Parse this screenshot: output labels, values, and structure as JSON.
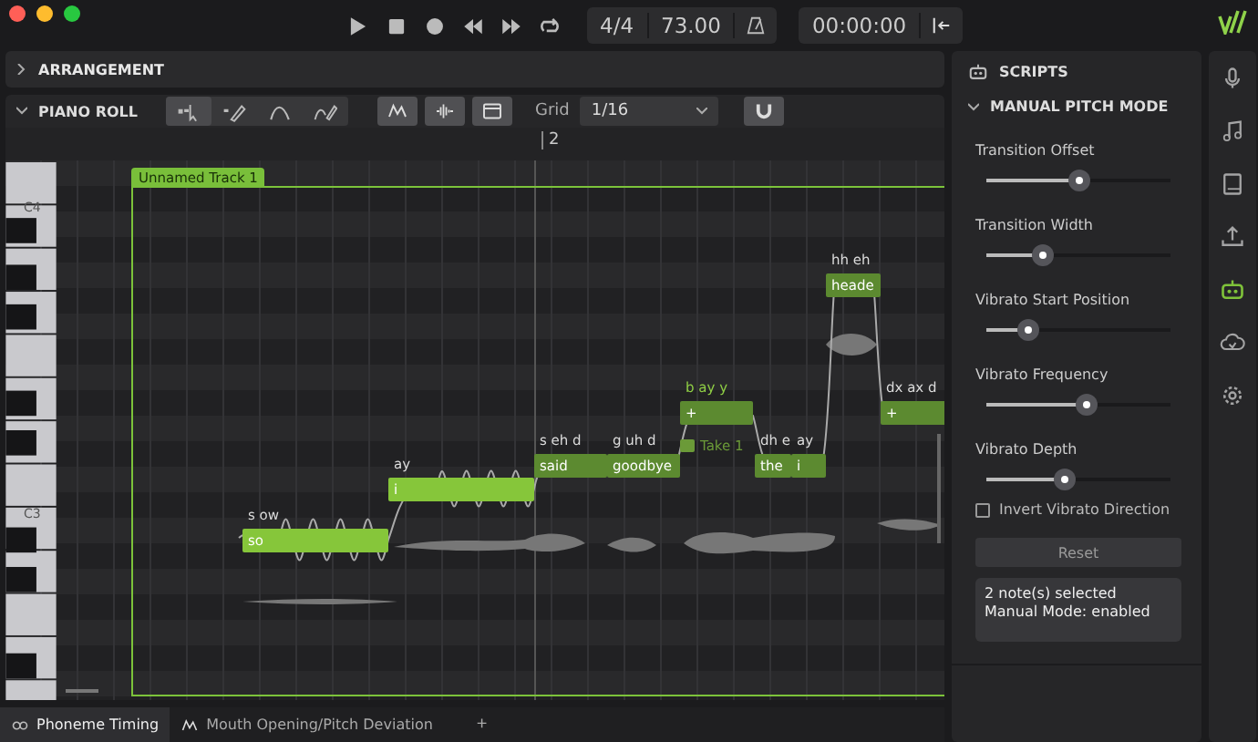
{
  "transport": {
    "buttons": [
      {
        "kind": "play"
      },
      {
        "kind": "stop"
      },
      {
        "kind": "record"
      },
      {
        "kind": "rewind"
      },
      {
        "kind": "forward"
      },
      {
        "kind": "loop"
      }
    ],
    "time_signature": "4/4",
    "tempo": "73.00",
    "time": "00:00:00"
  },
  "arrangement": {
    "title": "ARRANGEMENT",
    "expanded": false
  },
  "piano_roll": {
    "title": "PIANO ROLL",
    "expanded": true,
    "tools": [
      {
        "kind": "select",
        "selected": true
      },
      {
        "kind": "draw",
        "selected": false
      },
      {
        "kind": "pitch",
        "selected": false
      },
      {
        "kind": "pitch-pen",
        "selected": false
      }
    ],
    "toggles": [
      {
        "kind": "curve",
        "on": true
      },
      {
        "kind": "waveform",
        "on": true
      },
      {
        "kind": "clip",
        "on": true
      }
    ],
    "grid_label": "Grid",
    "grid_value": "1/16",
    "snap": {
      "on": true
    },
    "ruler": [
      "2"
    ],
    "keys": [
      "C4",
      "C3"
    ],
    "track": "Unnamed Track 1",
    "take": "Take 1",
    "notes": [
      {
        "lyric": "so",
        "phonemes": "s ow",
        "selected": true
      },
      {
        "lyric": "i",
        "phonemes": "ay",
        "selected": true
      },
      {
        "lyric": "said",
        "phonemes": "s eh d",
        "selected": false
      },
      {
        "lyric": "goodbye",
        "phonemes": "g uh d",
        "selected": false
      },
      {
        "lyric": "+",
        "phonemes": "b ay y",
        "selected": false
      },
      {
        "lyric": "the",
        "phonemes": "dh e",
        "selected": false
      },
      {
        "lyric": "i",
        "phonemes": "ay",
        "selected": false
      },
      {
        "lyric": "heade",
        "phonemes": "hh eh",
        "selected": false
      },
      {
        "lyric": "+",
        "phonemes": "dx ax d",
        "selected": false
      }
    ]
  },
  "bottom_tabs": [
    {
      "label": "Phoneme Timing",
      "kind": "timing",
      "selected": true
    },
    {
      "label": "Mouth Opening/Pitch Deviation",
      "kind": "curve",
      "selected": false
    }
  ],
  "bottom_add": "+",
  "scripts": {
    "title": "SCRIPTS",
    "section": "MANUAL PITCH MODE",
    "expanded": true,
    "sliders": [
      {
        "label": "Transition Offset",
        "level": 0.5
      },
      {
        "label": "Transition Width",
        "level": 0.31
      },
      {
        "label": "Vibrato Start Position",
        "level": 0.23
      },
      {
        "label": "Vibrato Frequency",
        "level": 0.54
      },
      {
        "label": "Vibrato Depth",
        "level": 0.43
      }
    ],
    "checkbox": {
      "label": "Invert Vibrato Direction",
      "checked": false
    },
    "reset": "Reset",
    "status": [
      "2 note(s) selected",
      "Manual Mode: enabled"
    ]
  },
  "sidebar": [
    {
      "kind": "mic",
      "selected": false
    },
    {
      "kind": "note",
      "selected": false
    },
    {
      "kind": "book",
      "selected": false
    },
    {
      "kind": "upload",
      "selected": false
    },
    {
      "kind": "robot",
      "selected": true
    },
    {
      "kind": "cloud",
      "selected": false
    },
    {
      "kind": "gear",
      "selected": false
    }
  ]
}
